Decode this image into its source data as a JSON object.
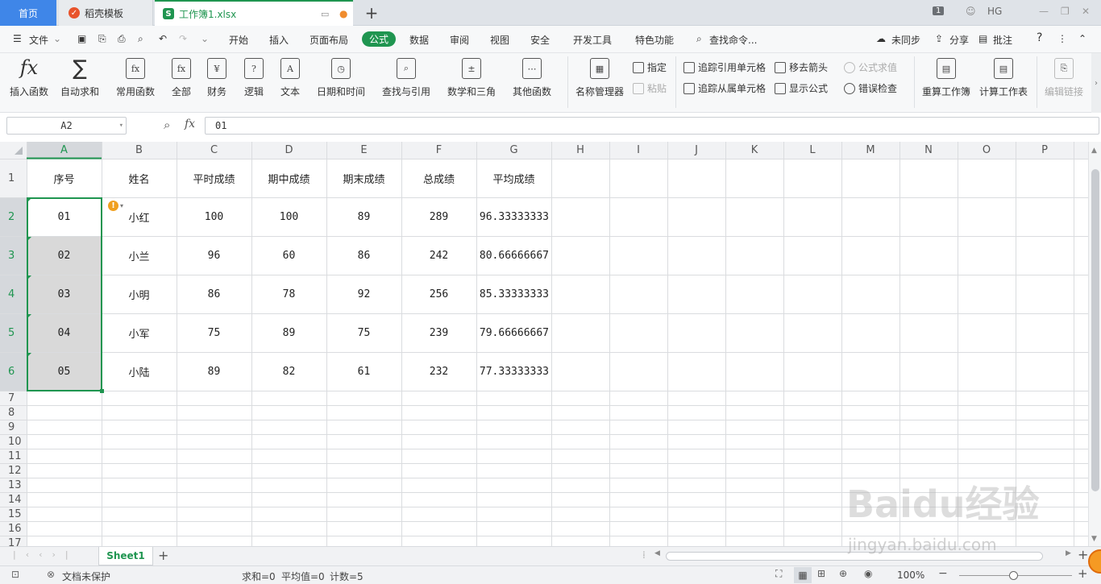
{
  "tabs": {
    "home": "首页",
    "template": "稻壳模板",
    "file": "工作簿1.xlsx",
    "add": "+"
  },
  "window": {
    "badge": "1",
    "user": "HG"
  },
  "menu": {
    "file": "文件",
    "items": [
      "开始",
      "插入",
      "页面布局",
      "公式",
      "数据",
      "审阅",
      "视图",
      "安全",
      "开发工具",
      "特色功能"
    ],
    "active": "公式",
    "search": "查找命令...",
    "sync": "未同步",
    "share": "分享",
    "comment": "批注",
    "help": "?"
  },
  "ribbon": {
    "insert_fn": "插入函数",
    "autosum": "自动求和",
    "common_fn": "常用函数",
    "all": "全部",
    "finance": "财务",
    "logic": "逻辑",
    "text": "文本",
    "datetime": "日期和时间",
    "lookup": "查找与引用",
    "math": "数学和三角",
    "other_fn": "其他函数",
    "name_mgr": "名称管理器",
    "specify": "指定",
    "paste": "粘贴",
    "trace_prec": "追踪引用单元格",
    "trace_dep": "追踪从属单元格",
    "remove_arrows": "移去箭头",
    "show_formula": "显示公式",
    "eval_formula": "公式求值",
    "error_check": "错误检查",
    "recalc_wb": "重算工作簿",
    "calc_sheet": "计算工作表",
    "edit_links": "编辑链接"
  },
  "formula_bar": {
    "name_box": "A2",
    "fx": "fx",
    "value": "01"
  },
  "sheet": {
    "columns": [
      "A",
      "B",
      "C",
      "D",
      "E",
      "F",
      "G",
      "H",
      "I",
      "J",
      "K",
      "L",
      "M",
      "N",
      "O",
      "P"
    ],
    "row_numbers": [
      "1",
      "2",
      "3",
      "4",
      "5",
      "6",
      "7",
      "8",
      "9",
      "10",
      "11",
      "12",
      "13",
      "14",
      "15",
      "16",
      "17"
    ],
    "header": [
      "序号",
      "姓名",
      "平时成绩",
      "期中成绩",
      "期末成绩",
      "总成绩",
      "平均成绩"
    ],
    "rows": [
      [
        "01",
        "小红",
        "100",
        "100",
        "89",
        "289",
        "96.33333333"
      ],
      [
        "02",
        "小兰",
        "96",
        "60",
        "86",
        "242",
        "80.66666667"
      ],
      [
        "03",
        "小明",
        "86",
        "78",
        "92",
        "256",
        "85.33333333"
      ],
      [
        "04",
        "小军",
        "75",
        "89",
        "75",
        "239",
        "79.66666667"
      ],
      [
        "05",
        "小陆",
        "89",
        "82",
        "61",
        "232",
        "77.33333333"
      ]
    ]
  },
  "sheet_tabs": {
    "active": "Sheet1",
    "add": "+"
  },
  "status": {
    "protect": "文档未保护",
    "sum": "求和=0",
    "avg": "平均值=0",
    "count": "计数=5",
    "zoom": "100%"
  },
  "watermark": {
    "brand": "Baidu经验",
    "url": "jingyan.baidu.com"
  },
  "colors": {
    "accent": "#1f9550",
    "home_tab": "#3f86e8",
    "selection": "#d9d9d9"
  }
}
